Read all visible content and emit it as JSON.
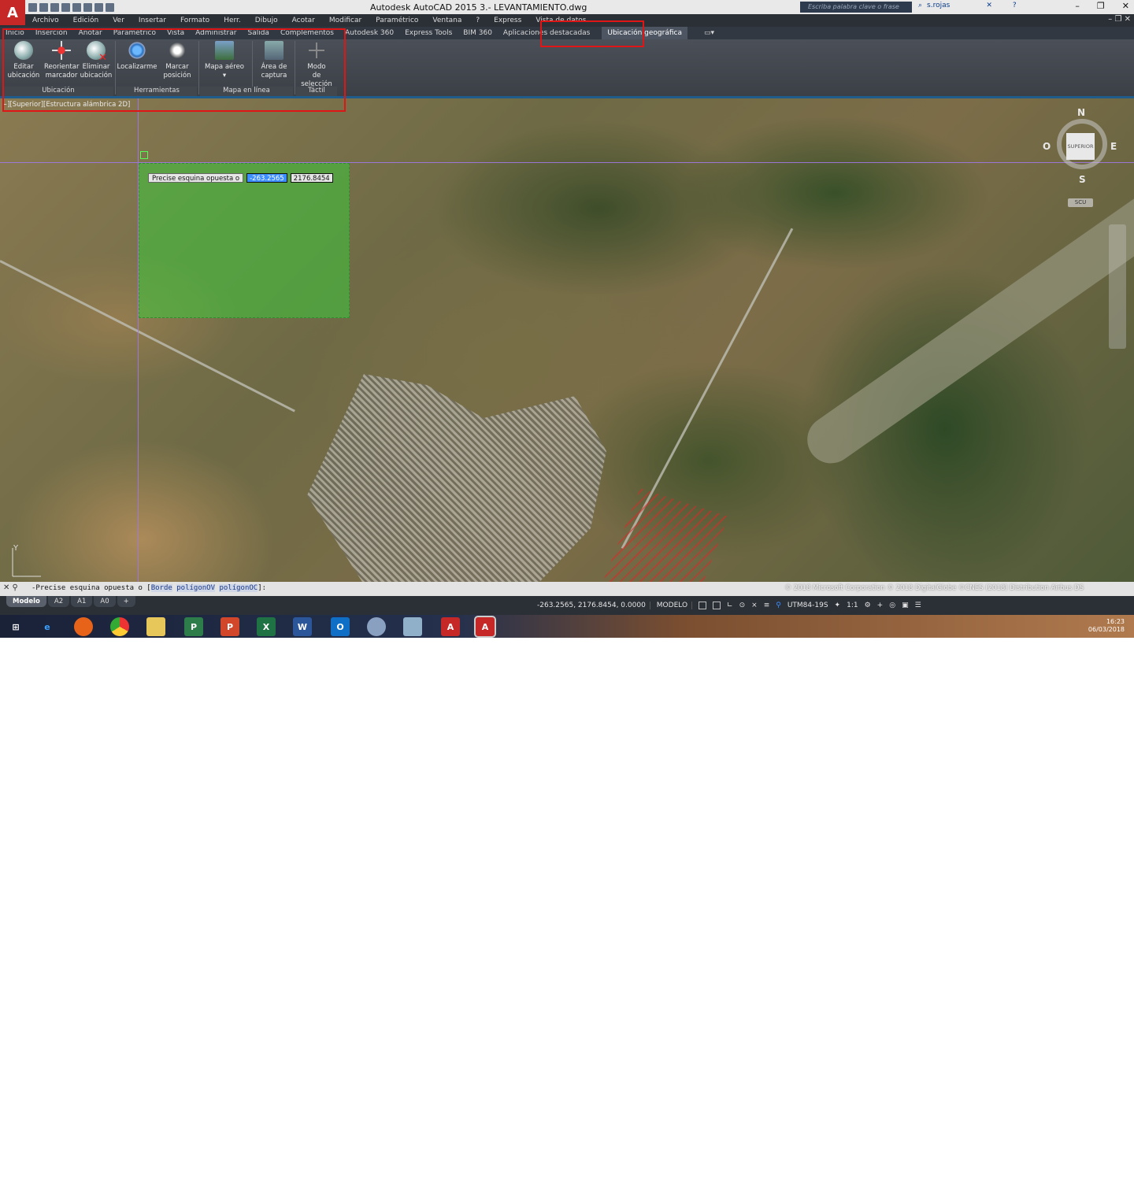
{
  "app": {
    "title": "Autodesk AutoCAD 2015    3.- LEVANTAMIENTO.dwg",
    "logo_letter": "A",
    "search_placeholder": "Escriba palabra clave o frase",
    "user": "s.rojas"
  },
  "menu": [
    "Archivo",
    "Edición",
    "Ver",
    "Insertar",
    "Formato",
    "Herr.",
    "Dibujo",
    "Acotar",
    "Modificar",
    "Paramétrico",
    "Ventana",
    "?",
    "Express",
    "Vista de datos"
  ],
  "ribbon_tabs": [
    "Inicio",
    "Inserción",
    "Anotar",
    "Paramétrico",
    "Vista",
    "Administrar",
    "Salida",
    "Complementos",
    "Autodesk 360",
    "Express Tools",
    "BIM 360",
    "Aplicaciones destacadas",
    "Ubicación geográfica"
  ],
  "ribbon": {
    "ubicacion": {
      "title": "Ubicación",
      "editar": [
        "Editar",
        "ubicación"
      ],
      "reorientar": [
        "Reorientar",
        "marcador"
      ],
      "eliminar": [
        "Eliminar",
        "ubicación"
      ]
    },
    "herramientas": {
      "title": "Herramientas",
      "localizarme": "Localizarme",
      "marcar": [
        "Marcar",
        "posición"
      ]
    },
    "mapa": {
      "title": "Mapa en línea",
      "aereo": "Mapa aéreo"
    },
    "captura": {
      "area": [
        "Área de",
        "captura"
      ]
    },
    "tactil": {
      "title": "Táctil",
      "modo": [
        "Modo",
        "de selección"
      ]
    }
  },
  "viewport": {
    "label": "−][Superior][Estructura alámbrica 2D]",
    "tooltip_label": "Precise esquina opuesta o",
    "x_value": "-263.2565",
    "y_value": "2176.8454",
    "compass": {
      "n": "N",
      "s": "S",
      "e": "E",
      "w": "O",
      "cube": "SUPERIOR",
      "scu": "SCU"
    },
    "ucs_y": "Y"
  },
  "command": {
    "prefix": "-Precise esquina opuesta o [",
    "opt1": "Borde",
    "opt2": "polígonOV",
    "opt3": "polígonOC",
    "suffix": "]:",
    "copyright": "© 2018 Microsoft Corporation © 2018 DigitalGlobe ©CNES (2018) Distribution Airbus DS"
  },
  "layout_tabs": [
    "Modelo",
    "A2",
    "A1",
    "A0",
    "+"
  ],
  "status": {
    "coords": "-263.2565, 2176.8454, 0.0000",
    "space": "MODELO",
    "coord_system": "UTM84-19S",
    "scale": "1:1"
  },
  "taskbar": {
    "time": "16:23",
    "date": "06/03/2018"
  }
}
